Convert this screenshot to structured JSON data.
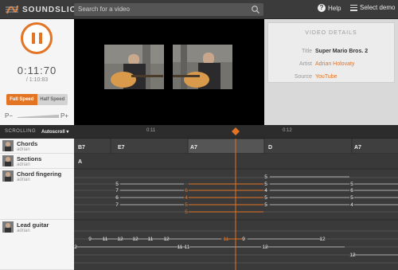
{
  "app": {
    "logo_text": "SOUNDSLICE",
    "logo_icon": "soundslice-logo-icon"
  },
  "search": {
    "placeholder": "Search for a video",
    "icon": "search-icon"
  },
  "nav": {
    "help_label": "Help",
    "help_icon": "question-icon",
    "demo_label": "Select demo",
    "demo_icon": "menu-icon"
  },
  "player": {
    "state": "playing",
    "current_time": "0:11:70",
    "duration": "/ 1:10:83",
    "speed_full": "Full Speed",
    "speed_half": "Half Speed",
    "active_speed": "full",
    "zoom_out_icon": "zoom-out-icon",
    "zoom_in_icon": "zoom-in-icon",
    "zoom_minus": "P−",
    "zoom_plus": "P+",
    "zoom_level": 0.3
  },
  "video_details": {
    "heading": "VIDEO DETAILS",
    "title_label": "Title",
    "title_value": "Super Mario Bros. 2",
    "artist_label": "Artist",
    "artist_value": "Adrian Holovaty",
    "source_label": "Source",
    "source_value": "YouTube"
  },
  "timeline": {
    "scrolling_label": "SCROLLING",
    "autoscroll_label": "Autoscroll ▾",
    "markers": [
      "0:11",
      "0:12"
    ]
  },
  "tracks": [
    {
      "name": "Chords",
      "author": "adrian"
    },
    {
      "name": "Sections",
      "author": "adrian"
    },
    {
      "name": "Chord fingering",
      "author": "adrian"
    },
    {
      "name": "Lead guitar",
      "author": "adrian"
    }
  ],
  "chords": [
    "B7",
    "E7",
    "A7",
    "D",
    "A7"
  ],
  "sections": [
    "A"
  ],
  "fingering_numbers": {
    "col1": [
      "5",
      "7",
      "6",
      "7"
    ],
    "col2": [
      "6",
      "4",
      "5",
      "5"
    ],
    "col3": [
      "5",
      "5",
      "4",
      "5",
      "5"
    ],
    "col4": [
      "6",
      "5",
      "4",
      "5"
    ]
  },
  "lead_numbers": [
    "9",
    "11",
    "12",
    "11",
    "12",
    "11",
    "12",
    "11",
    "9",
    "11",
    "12",
    "12",
    "12",
    "11",
    "11",
    "12",
    "2",
    "12"
  ],
  "colors": {
    "accent": "#e27424",
    "details_link": "#e27424"
  }
}
